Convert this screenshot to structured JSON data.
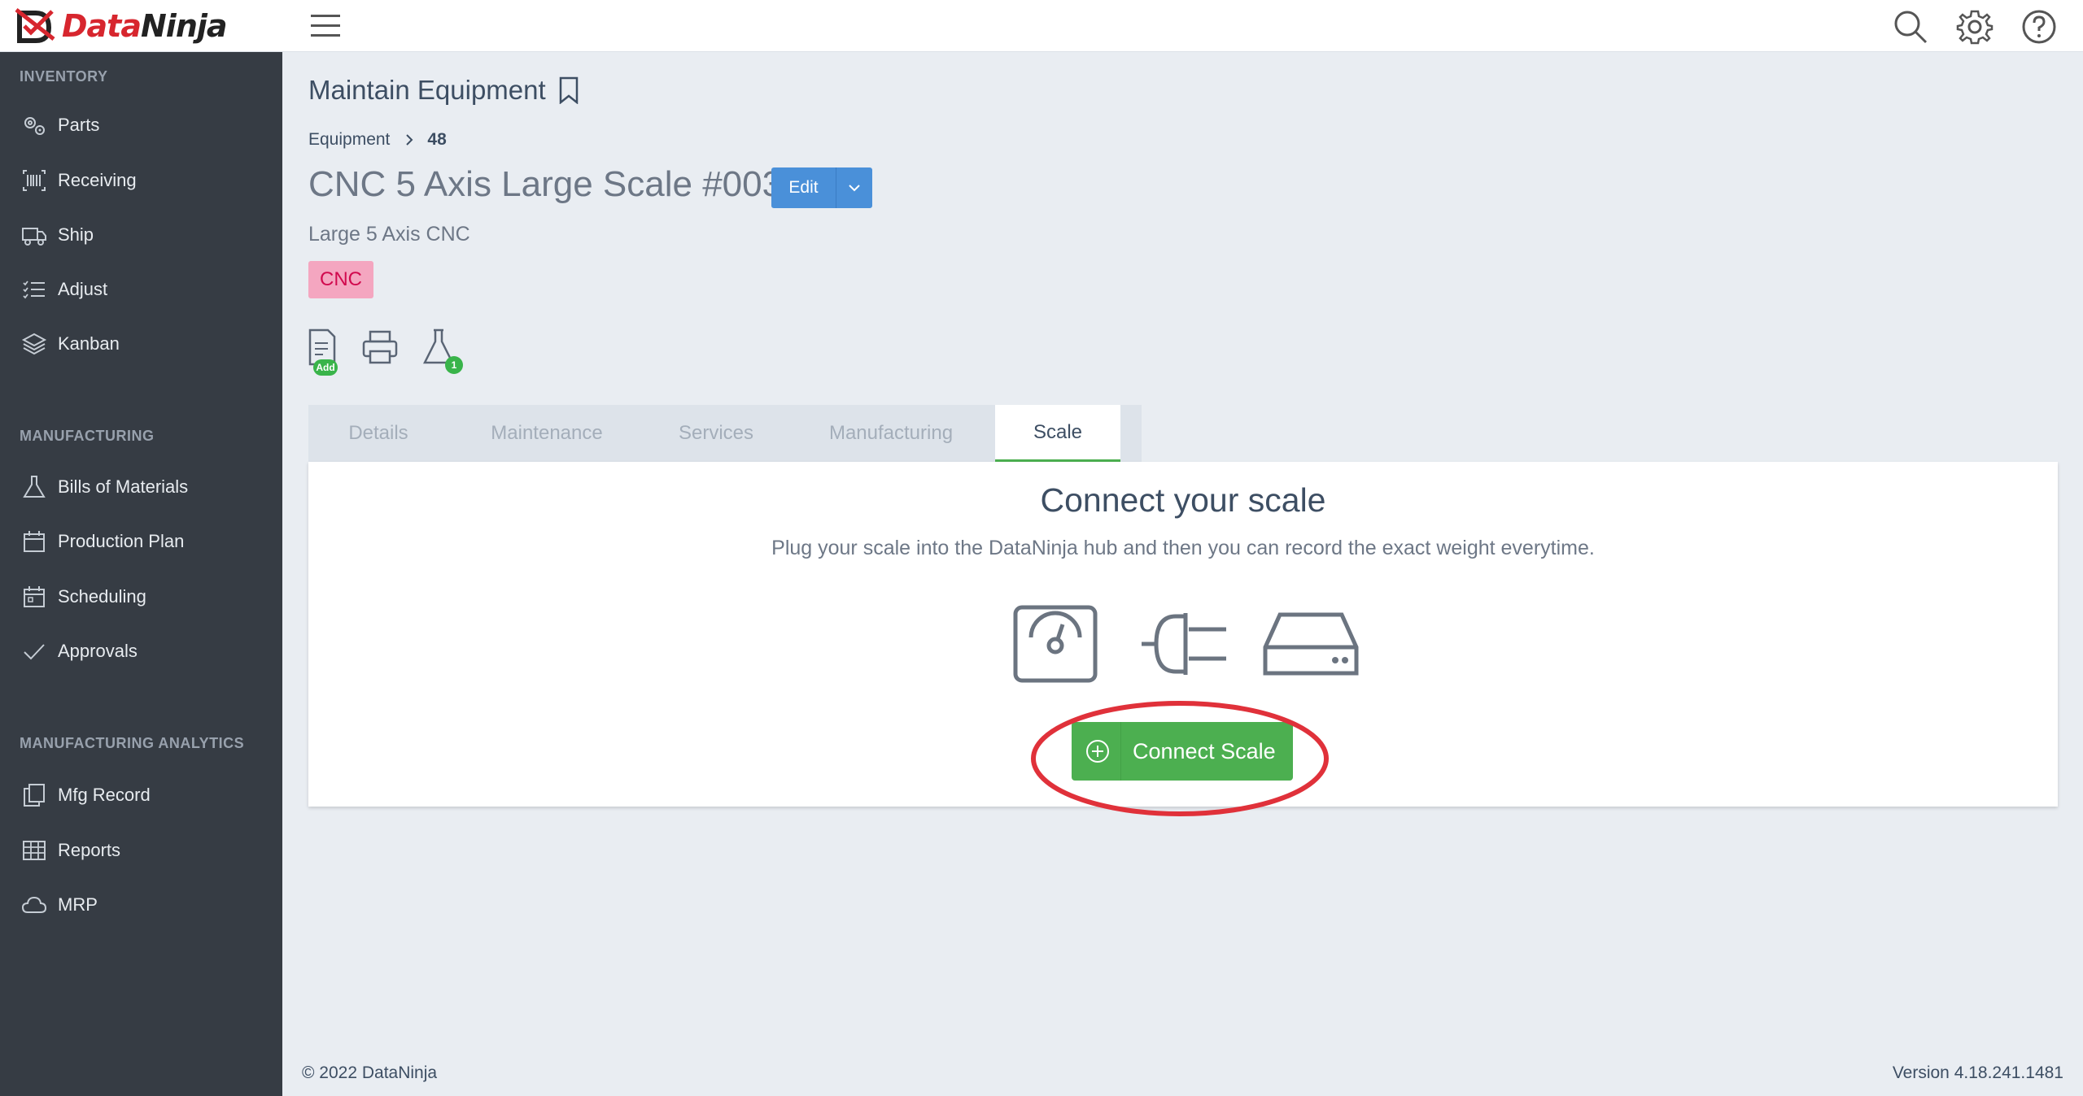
{
  "brand": {
    "name_part1": "Data",
    "name_part2": "Ninja",
    "accent": "#d7262e"
  },
  "topbar": {
    "icons": [
      "menu-icon",
      "search-icon",
      "gear-icon",
      "help-icon"
    ]
  },
  "sidebar": {
    "sections": [
      {
        "title": "INVENTORY",
        "items": [
          {
            "label": "Parts",
            "icon": "gears-icon"
          },
          {
            "label": "Receiving",
            "icon": "barcode-icon"
          },
          {
            "label": "Ship",
            "icon": "truck-icon"
          },
          {
            "label": "Adjust",
            "icon": "checklist-icon"
          },
          {
            "label": "Kanban",
            "icon": "layers-icon"
          }
        ]
      },
      {
        "title": "MANUFACTURING",
        "items": [
          {
            "label": "Bills of Materials",
            "icon": "flask-icon"
          },
          {
            "label": "Production Plan",
            "icon": "calendar-icon"
          },
          {
            "label": "Scheduling",
            "icon": "calendar-grid-icon"
          },
          {
            "label": "Approvals",
            "icon": "check-icon"
          }
        ]
      },
      {
        "title": "MANUFACTURING ANALYTICS",
        "items": [
          {
            "label": "Mfg Record",
            "icon": "copy-icon"
          },
          {
            "label": "Reports",
            "icon": "table-icon"
          },
          {
            "label": "MRP",
            "icon": "cloud-icon"
          }
        ]
      }
    ]
  },
  "page": {
    "title": "Maintain Equipment",
    "breadcrumb": {
      "parent": "Equipment",
      "current": "48"
    },
    "item_title": "CNC 5 Axis Large Scale #003",
    "edit_label": "Edit",
    "subtitle": "Large 5 Axis CNC",
    "tag": "CNC",
    "actions": {
      "add_badge": "Add",
      "flask_badge": "1"
    }
  },
  "tabs": [
    "Details",
    "Maintenance",
    "Services",
    "Manufacturing",
    "Scale"
  ],
  "active_tab": "Scale",
  "scale_panel": {
    "title": "Connect your scale",
    "description": "Plug your scale into the DataNinja hub and then you can record the exact weight everytime.",
    "button_label": "Connect Scale"
  },
  "footer": {
    "copyright": "© 2022 DataNinja",
    "version": "Version 4.18.241.1481"
  }
}
